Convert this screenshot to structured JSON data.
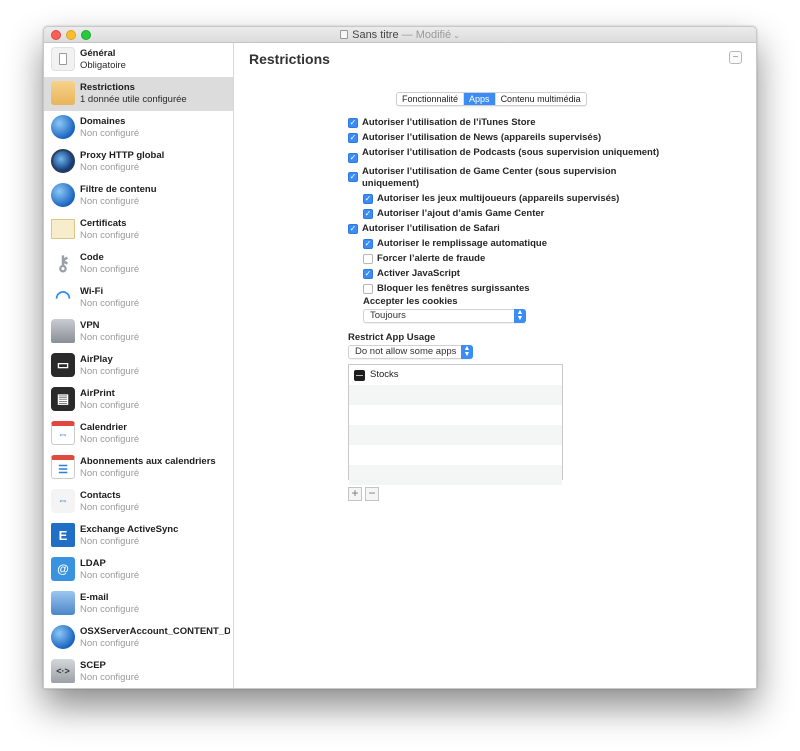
{
  "window": {
    "title": "Sans titre",
    "title_separator": " — ",
    "status": "Modifié",
    "title_chevron": "⌄"
  },
  "sidebar": {
    "items": [
      {
        "name": "Général",
        "status": "Obligatoire",
        "icon": "general-icon",
        "selected": false
      },
      {
        "name": "Restrictions",
        "status": "1 donnée utile configurée",
        "icon": "restrictions-icon",
        "selected": true
      },
      {
        "name": "Domaines",
        "status": "Non configuré",
        "icon": "domains-globe-icon",
        "selected": false
      },
      {
        "name": "Proxy HTTP global",
        "status": "Non configuré",
        "icon": "proxy-globe-icon",
        "selected": false
      },
      {
        "name": "Filtre de contenu",
        "status": "Non configuré",
        "icon": "content-filter-globe-icon",
        "selected": false
      },
      {
        "name": "Certificats",
        "status": "Non configuré",
        "icon": "certificate-icon",
        "selected": false
      },
      {
        "name": "Code",
        "status": "Non configuré",
        "icon": "key-icon",
        "selected": false
      },
      {
        "name": "Wi-Fi",
        "status": "Non configuré",
        "icon": "wifi-icon",
        "selected": false
      },
      {
        "name": "VPN",
        "status": "Non configuré",
        "icon": "vpn-lock-icon",
        "selected": false
      },
      {
        "name": "AirPlay",
        "status": "Non configuré",
        "icon": "airplay-icon",
        "selected": false
      },
      {
        "name": "AirPrint",
        "status": "Non configuré",
        "icon": "printer-icon",
        "selected": false
      },
      {
        "name": "Calendrier",
        "status": "Non configuré",
        "icon": "calendar-sync-icon",
        "selected": false
      },
      {
        "name": "Abonnements aux calendriers",
        "status": "Non configuré",
        "icon": "calendar-subscription-icon",
        "selected": false
      },
      {
        "name": "Contacts",
        "status": "Non configuré",
        "icon": "contacts-icon",
        "selected": false
      },
      {
        "name": "Exchange ActiveSync",
        "status": "Non configuré",
        "icon": "exchange-icon",
        "selected": false
      },
      {
        "name": "LDAP",
        "status": "Non configuré",
        "icon": "ldap-at-icon",
        "selected": false
      },
      {
        "name": "E-mail",
        "status": "Non configuré",
        "icon": "mail-icon",
        "selected": false
      },
      {
        "name": "OSXServerAccount_CONTENT_DIS",
        "status": "Non configuré",
        "icon": "server-globe-icon",
        "selected": false
      },
      {
        "name": "SCEP",
        "status": "Non configuré",
        "icon": "scep-lock-icon",
        "selected": false
      }
    ]
  },
  "main": {
    "title": "Restrictions",
    "collapse_symbol": "−",
    "tabs": [
      {
        "label": "Fonctionnalité",
        "active": false
      },
      {
        "label": "Apps",
        "active": true
      },
      {
        "label": "Contenu multimédia",
        "active": false
      }
    ],
    "options": [
      {
        "label": "Autoriser l’utilisation de l’iTunes Store",
        "checked": true,
        "indent": false
      },
      {
        "label": "Autoriser l’utilisation de News (appareils supervisés)",
        "checked": true,
        "indent": false
      },
      {
        "label": "Autoriser l’utilisation de Podcasts (sous supervision uniquement)",
        "checked": true,
        "indent": false
      },
      {
        "label": "Autoriser l’utilisation de Game Center (sous supervision uniquement)",
        "checked": true,
        "indent": false
      },
      {
        "label": "Autoriser les jeux multijoueurs (appareils supervisés)",
        "checked": true,
        "indent": true
      },
      {
        "label": "Autoriser l’ajout d’amis Game Center",
        "checked": true,
        "indent": true
      },
      {
        "label": "Autoriser l’utilisation de Safari",
        "checked": true,
        "indent": false
      },
      {
        "label": "Autoriser le remplissage automatique",
        "checked": true,
        "indent": true
      },
      {
        "label": "Forcer l’alerte de fraude",
        "checked": false,
        "indent": true
      },
      {
        "label": "Activer JavaScript",
        "checked": true,
        "indent": true
      },
      {
        "label": "Bloquer les fenêtres surgissantes",
        "checked": false,
        "indent": true
      }
    ],
    "cookies": {
      "label": "Accepter les cookies",
      "value": "Toujours"
    },
    "restrict_app_usage": {
      "label": "Restrict App Usage",
      "value": "Do not allow some apps",
      "apps": [
        "Stocks"
      ],
      "empty_rows": 5,
      "add_label": "+",
      "remove_label": "−"
    },
    "checkmark": "✓",
    "popup_arrows": "▲▼"
  }
}
